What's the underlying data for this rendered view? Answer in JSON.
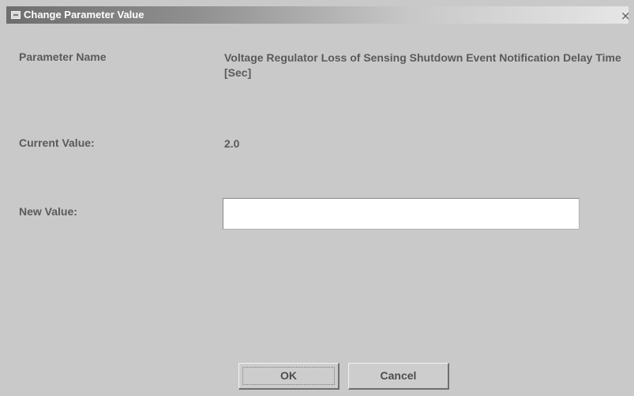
{
  "window": {
    "title": "Change Parameter Value",
    "close_glyph": "×",
    "icon": "window-app-icon"
  },
  "form": {
    "parameter_name_label": "Parameter Name",
    "parameter_name_value": "Voltage Regulator Loss of Sensing Shutdown Event Notification Delay Time [Sec]",
    "current_value_label": "Current Value:",
    "current_value": "2.0",
    "new_value_label": "New Value:",
    "new_value_input": "",
    "new_value_placeholder": ""
  },
  "buttons": {
    "ok_label": "OK",
    "cancel_label": "Cancel"
  },
  "colors": {
    "dialog_background": "#c9c9c9",
    "text": "#5a5a5a",
    "titlebar_dark": "#6e6e6e",
    "titlebar_light": "#e6e6e6"
  }
}
